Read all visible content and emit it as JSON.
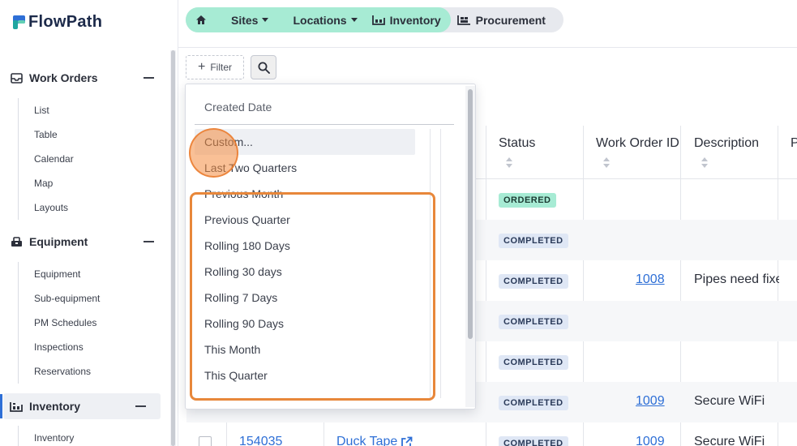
{
  "app": {
    "name": "FlowPath",
    "accent": "#2e6fd6",
    "teal": "#a7ebd4",
    "highlight": "#e8873a"
  },
  "sidebar": {
    "sections": [
      {
        "label": "Work Orders",
        "icon": "inbox-icon",
        "items": [
          "List",
          "Table",
          "Calendar",
          "Map",
          "Layouts"
        ]
      },
      {
        "label": "Equipment",
        "icon": "equipment-icon",
        "items": [
          "Equipment",
          "Sub-equipment",
          "PM Schedules",
          "Inspections",
          "Reservations"
        ]
      },
      {
        "label": "Inventory",
        "icon": "warehouse-icon",
        "active": true,
        "items": [
          "Inventory"
        ]
      }
    ]
  },
  "breadcrumb": {
    "items": [
      {
        "label": "",
        "icon": "home-icon"
      },
      {
        "label": "Sites",
        "dropdown": true
      },
      {
        "label": "Locations",
        "dropdown": true
      },
      {
        "label": "Inventory",
        "icon": "warehouse-icon"
      },
      {
        "label": "Procurement",
        "icon": "procurement-icon"
      }
    ]
  },
  "toolbar": {
    "filter_label": "Filter"
  },
  "dropdown": {
    "field_label": "Created Date",
    "options": [
      "Custom...",
      "Last Two Quarters",
      "Previous Month",
      "Previous Quarter",
      "Rolling 180 Days",
      "Rolling 30 days",
      "Rolling 7 Days",
      "Rolling 90 Days",
      "This Month",
      "This Quarter"
    ],
    "hovered_index": 0
  },
  "table": {
    "columns": [
      "Status",
      "Work Order ID",
      "Description",
      "P"
    ],
    "rows": [
      {
        "status": "ORDERED",
        "work_order": "",
        "description": ""
      },
      {
        "status": "COMPLETED",
        "work_order": "",
        "description": ""
      },
      {
        "status": "COMPLETED",
        "work_order": "1008",
        "description": "Pipes need fixe"
      },
      {
        "status": "COMPLETED",
        "work_order": "",
        "description": ""
      },
      {
        "status": "COMPLETED",
        "work_order": "",
        "description": ""
      },
      {
        "status": "COMPLETED",
        "work_order": "1009",
        "description": "Secure WiFi"
      },
      {
        "status": "COMPLETED",
        "work_order": "1009",
        "description": "Secure WiFi",
        "id": "154035",
        "item": "Duck Tape"
      }
    ]
  }
}
